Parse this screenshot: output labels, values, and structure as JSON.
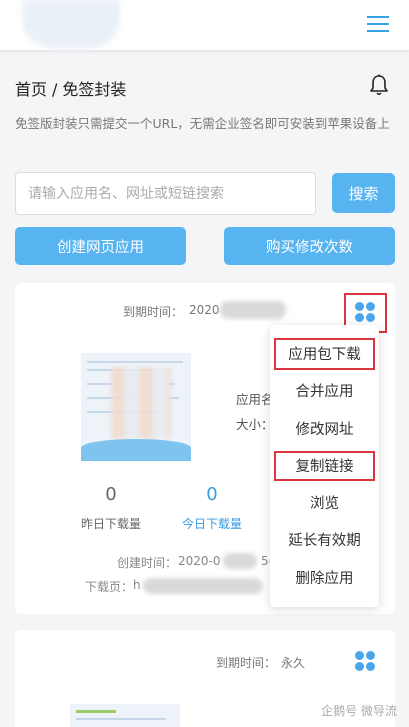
{
  "header": {
    "logo_icon": "blurred-logo",
    "menu_icon": "hamburger-menu-icon"
  },
  "breadcrumb": {
    "home": "首页",
    "separator": "/",
    "current": "免签封装"
  },
  "notification_icon": "bell-icon",
  "description": "免签版封装只需提交一个URL，无需企业签名即可安装到苹果设备上",
  "search": {
    "placeholder": "请输入应用名、网址或短链搜索",
    "button": "搜索"
  },
  "actions": {
    "create": "创建网页应用",
    "buy": "购买修改次数"
  },
  "app_cards": [
    {
      "expiry_label": "到期时间：",
      "expiry_value": "2020",
      "app_name_label": "应用名",
      "size_label": "大小：",
      "stats": [
        {
          "value": "0",
          "label": "昨日下载量"
        },
        {
          "value": "0",
          "label": "今日下载量"
        }
      ],
      "created_label": "创建时间：",
      "created_value": "2020-0",
      "created_suffix": "5(",
      "download_label": "下载页：",
      "download_value": "h"
    },
    {
      "expiry_label": "到期时间：",
      "expiry_value": "永久"
    }
  ],
  "menu_items": [
    "应用包下载",
    "合并应用",
    "修改网址",
    "复制链接",
    "浏览",
    "延长有效期",
    "删除应用"
  ],
  "watermark": "企鹅号 微导流",
  "colors": {
    "accent": "#58b4f0",
    "icon_blue": "#4aa6ea",
    "highlight_red": "#d9363e",
    "stat_blue": "#3a9be0"
  }
}
